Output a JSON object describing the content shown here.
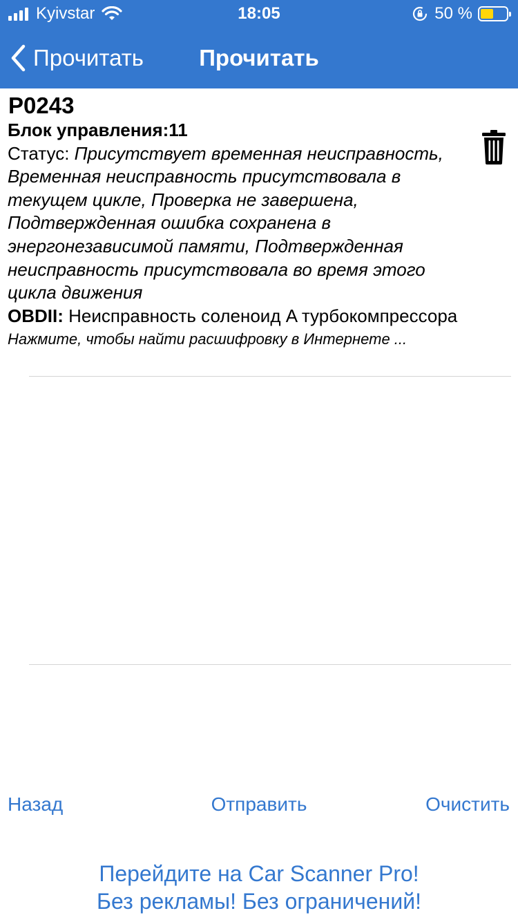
{
  "status_bar": {
    "carrier": "Kyivstar",
    "time": "18:05",
    "battery_percent": "50 %",
    "battery_level": 0.5,
    "icons": [
      "signal-icon",
      "wifi-icon",
      "orientation-lock-icon",
      "battery-icon"
    ]
  },
  "nav": {
    "back_label": "Прочитать",
    "title": "Прочитать"
  },
  "dtc": {
    "code": "P0243",
    "ecu_label": "Блок управления:",
    "ecu_value": "11",
    "status_label": "Статус: ",
    "status_value": "Присутствует временная неисправность, Временная неисправность присутствовала в текущем цикле, Проверка не завершена, Подтвержденная ошибка сохранена в энергонезависимой памяти, Подтвержденная неисправность присутствовала во время этого цикла движения",
    "obd_label": "OBDII:",
    "obd_value": " Неисправность соленоид A турбокомпрессора",
    "hint": "Нажмите, чтобы найти расшифровку в Интернете ..."
  },
  "bottom": {
    "back": "Назад",
    "send": "Отправить",
    "clear": "Очистить"
  },
  "promo": {
    "line1": "Перейдите на Car Scanner Pro!",
    "line2": "Без рекламы! Без ограничений!"
  },
  "colors": {
    "accent": "#3478cf",
    "battery": "#ffd60a"
  }
}
